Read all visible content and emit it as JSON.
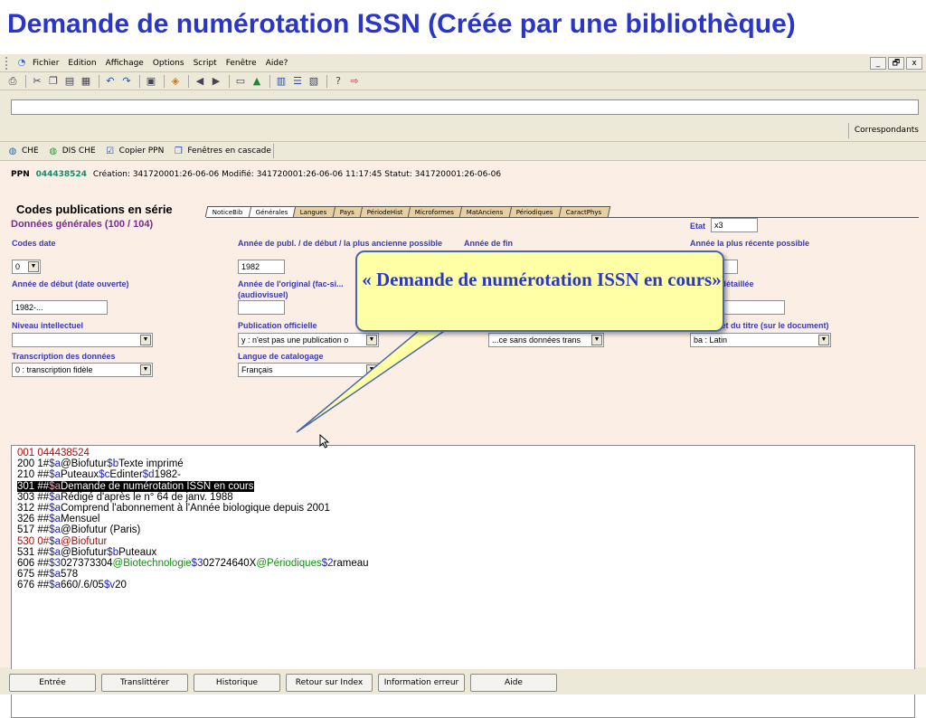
{
  "slide": {
    "title": "Demande de numérotation ISSN (Créée par une bibliothèque)"
  },
  "menubar": {
    "items": [
      "Fichier",
      "Edition",
      "Affichage",
      "Options",
      "Script",
      "Fenêtre",
      "Aide?"
    ],
    "window_controls": [
      "_",
      "🗗",
      "x"
    ]
  },
  "toolbar": {
    "icons": [
      "print-icon",
      "cut-icon",
      "copy-icon",
      "paste-icon",
      "clipboard-icon",
      "undo-icon",
      "redo-icon",
      "document-icon",
      "paint-icon",
      "back-icon",
      "forward-icon",
      "monitor-icon",
      "chart-icon",
      "grid-icon",
      "list-icon",
      "page-icon",
      "help-icon",
      "arrow-icon"
    ]
  },
  "right_panel": {
    "correspondants_label": "Correspondants"
  },
  "subtoolbar": {
    "items": [
      {
        "label": "CHE",
        "icon": "globe-icon"
      },
      {
        "label": "DIS CHE",
        "icon": "globe-icon"
      },
      {
        "label": "Copier PPN",
        "icon": "copy-icon"
      },
      {
        "label": "Fenêtres en cascade",
        "icon": "windows-icon"
      }
    ]
  },
  "record": {
    "ppn_label": "PPN",
    "ppn": "044438524",
    "meta": "Création: 341720001:26-06-06 Modifié: 341720001:26-06-06 11:17:45 Statut: 341720001:26-06-06",
    "codes_title": "Codes publications en série",
    "tabs": [
      "NoticeBib",
      "Générales",
      "Langues",
      "Pays",
      "PériodeHist",
      "Microformes",
      "MatAnciens",
      "Périodiques",
      "CaractPhys"
    ],
    "section_title": "Données générales (100 / 104)",
    "etat_label": "Etat",
    "etat_value": "x3",
    "fields": {
      "codes_date": {
        "label": "Codes date",
        "value": "0"
      },
      "annee_publ": {
        "label": "Année de publ. / de début / la plus ancienne possible",
        "value": "1982"
      },
      "annee_fin": {
        "label": "Année de fin",
        "value": ""
      },
      "annee_recente": {
        "label": "Année la plus récente possible",
        "value": ""
      },
      "annee_debut_ouverte": {
        "label": "Année de début (date ouverte)",
        "value": "1982-..."
      },
      "annee_original": {
        "label": "Année de l'original (fac-si... (audiovisuel)",
        "value": ""
      },
      "detaillee": {
        "label": "...détaillée",
        "value": ""
      },
      "niveau_intellectuel": {
        "label": "Niveau intellectuel",
        "value": ""
      },
      "publication_officielle": {
        "label": "Publication officielle",
        "value": "y : n'est pas une publication o"
      },
      "middle_select": {
        "value": "...ce sans données trans"
      },
      "alphabet_titre": {
        "label": "...et du titre (sur le document)",
        "value": "ba : Latin"
      },
      "transcription": {
        "label": "Transcription des données",
        "value": "0 : transcription fidèle"
      },
      "langue_catalogage": {
        "label": "Langue de catalogage",
        "value": "Français"
      }
    }
  },
  "unimarc": {
    "lines": [
      [
        {
          "t": "001 044438524",
          "c": "r"
        }
      ],
      [
        {
          "t": "200 1#",
          "c": ""
        },
        {
          "t": "$a",
          "c": "b"
        },
        {
          "t": "@Biofutur",
          "c": ""
        },
        {
          "t": "$b",
          "c": "b"
        },
        {
          "t": "Texte imprimé",
          "c": ""
        }
      ],
      [
        {
          "t": "210 ##",
          "c": ""
        },
        {
          "t": "$a",
          "c": "b"
        },
        {
          "t": "Puteaux",
          "c": ""
        },
        {
          "t": "$c",
          "c": "b"
        },
        {
          "t": "Edinter",
          "c": ""
        },
        {
          "t": "$d",
          "c": "b"
        },
        {
          "t": "1982-",
          "c": ""
        }
      ],
      [
        {
          "t": "301 ##",
          "c": "hl"
        },
        {
          "t": "$a",
          "c": "hlb"
        },
        {
          "t": "Demande de numérotation ISSN en cours",
          "c": "hl"
        }
      ],
      [
        {
          "t": "303 ##",
          "c": ""
        },
        {
          "t": "$a",
          "c": "b"
        },
        {
          "t": "Rédigé d'après le n° 64 de janv. 1988",
          "c": ""
        }
      ],
      [
        {
          "t": "312 ##",
          "c": ""
        },
        {
          "t": "$a",
          "c": "b"
        },
        {
          "t": "Comprend l'abonnement à l'Année biologique depuis 2001",
          "c": ""
        }
      ],
      [
        {
          "t": "326 ##",
          "c": ""
        },
        {
          "t": "$a",
          "c": "b"
        },
        {
          "t": "Mensuel",
          "c": ""
        }
      ],
      [
        {
          "t": "517 ##",
          "c": ""
        },
        {
          "t": "$a",
          "c": "b"
        },
        {
          "t": "@Biofutur (Paris)",
          "c": ""
        }
      ],
      [
        {
          "t": "530 0#",
          "c": "r"
        },
        {
          "t": "$a",
          "c": "b"
        },
        {
          "t": "@Biofutur",
          "c": "r"
        }
      ],
      [
        {
          "t": "531 ##",
          "c": ""
        },
        {
          "t": "$a",
          "c": "b"
        },
        {
          "t": "@Biofutur",
          "c": ""
        },
        {
          "t": "$b",
          "c": "b"
        },
        {
          "t": "Puteaux",
          "c": ""
        }
      ],
      [
        {
          "t": "606 ##",
          "c": ""
        },
        {
          "t": "$3",
          "c": "b"
        },
        {
          "t": "027373304",
          "c": ""
        },
        {
          "t": "@Biotechnologie",
          "c": "g"
        },
        {
          "t": "$3",
          "c": "b"
        },
        {
          "t": "02724640X",
          "c": ""
        },
        {
          "t": "@Périodiques",
          "c": "g"
        },
        {
          "t": "$2",
          "c": "b"
        },
        {
          "t": "rameau",
          "c": ""
        }
      ],
      [
        {
          "t": "675 ##",
          "c": ""
        },
        {
          "t": "$a",
          "c": "b"
        },
        {
          "t": "578",
          "c": ""
        }
      ],
      [
        {
          "t": "676 ##",
          "c": ""
        },
        {
          "t": "$a",
          "c": "b"
        },
        {
          "t": "660/.6/05",
          "c": ""
        },
        {
          "t": "$v",
          "c": "b"
        },
        {
          "t": "20",
          "c": ""
        }
      ]
    ]
  },
  "buttons": {
    "entree": "Entrée",
    "translitterer": "Translittérer",
    "historique": "Historique",
    "retour_index": "Retour sur Index",
    "information_erreur": "Information erreur",
    "aide": "Aide"
  },
  "callout": {
    "text": "« Demande de numérotation ISSN en cours»"
  },
  "colors": {
    "title_blue": "#2a36c8",
    "callout_fill": "#ffffa6",
    "ppn_green": "#108f6a",
    "label_blue": "#3a3ab0",
    "section_purple": "#7b2b8c"
  }
}
